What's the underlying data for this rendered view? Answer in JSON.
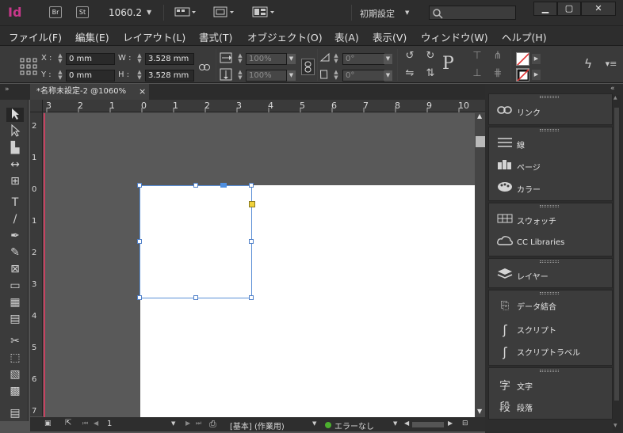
{
  "titlebar": {
    "logo": "Id",
    "bridge": "Br",
    "stock": "St",
    "zoom": "1060.2",
    "zoom_arrow": "▼",
    "workspace": "初期設定",
    "workspace_arrow": "▼",
    "search_placeholder": "",
    "minimize": "▁",
    "maximize": "▢",
    "close": "✕"
  },
  "menu": [
    "ファイル(F)",
    "編集(E)",
    "レイアウト(L)",
    "書式(T)",
    "オブジェクト(O)",
    "表(A)",
    "表示(V)",
    "ウィンドウ(W)",
    "ヘルプ(H)"
  ],
  "control": {
    "x_label": "X :",
    "y_label": "Y :",
    "w_label": "W :",
    "h_label": "H :",
    "x_value": "0 mm",
    "y_value": "0 mm",
    "w_value": "3.528 mm",
    "h_value": "3.528 mm",
    "scale_x": "100%",
    "scale_y": "100%",
    "rotate": "0°",
    "shear": "0°",
    "p_label": "P"
  },
  "document": {
    "tab_title": "*名称未設定-2 @1060%",
    "tab_close": "×"
  },
  "ruler": {
    "h_labels": [
      "3",
      "2",
      "1",
      "0",
      "1",
      "2",
      "3",
      "4",
      "5",
      "6",
      "7",
      "8",
      "9",
      "10"
    ],
    "v_labels": [
      "2",
      "1",
      "0",
      "1",
      "2",
      "3",
      "4",
      "5",
      "6",
      "7"
    ]
  },
  "status": {
    "page_number": "1",
    "master": "[基本] (作業用)",
    "errors": "エラーなし",
    "error_color": "#4caf2e"
  },
  "panels": [
    {
      "icon": "link-icon",
      "label": "リンク"
    },
    {
      "icon": "stroke-icon",
      "label": "線"
    },
    {
      "icon": "pages-icon",
      "label": "ページ"
    },
    {
      "icon": "color-icon",
      "label": "カラー"
    },
    {
      "icon": "swatches-icon",
      "label": "スウォッチ"
    },
    {
      "icon": "cc-libraries-icon",
      "label": "CC Libraries"
    },
    {
      "icon": "layers-icon",
      "label": "レイヤー"
    },
    {
      "icon": "data-merge-icon",
      "label": "データ結合"
    },
    {
      "icon": "scripts-icon",
      "label": "スクリプト"
    },
    {
      "icon": "script-label-icon",
      "label": "スクリプトラベル"
    },
    {
      "icon": "character-icon",
      "label": "文字"
    },
    {
      "icon": "paragraph-icon",
      "label": "段落"
    }
  ],
  "colors": {
    "accent_logo": "#c8388b",
    "selection": "#5a8fd6",
    "bleed": "#c8405f"
  }
}
